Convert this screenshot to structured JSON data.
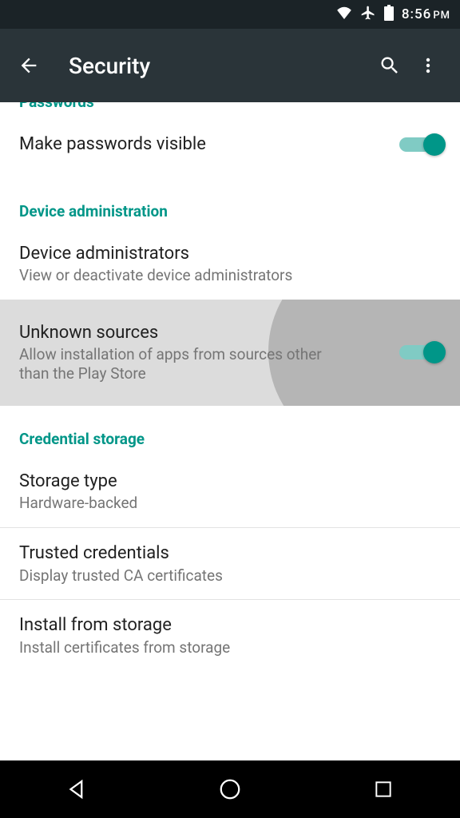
{
  "status": {
    "time": "8:56",
    "period": "PM"
  },
  "appbar": {
    "title": "Security"
  },
  "sections": {
    "passwords": {
      "header": "Passwords",
      "make_visible": "Make passwords visible"
    },
    "device_admin": {
      "header": "Device administration",
      "administrators_title": "Device administrators",
      "administrators_sub": "View or deactivate device administrators",
      "unknown_title": "Unknown sources",
      "unknown_sub": "Allow installation of apps from sources other than the Play Store"
    },
    "credential": {
      "header": "Credential storage",
      "storage_title": "Storage type",
      "storage_sub": "Hardware-backed",
      "trusted_title": "Trusted credentials",
      "trusted_sub": "Display trusted CA certificates",
      "install_title": "Install from storage",
      "install_sub": "Install certificates from storage"
    }
  }
}
